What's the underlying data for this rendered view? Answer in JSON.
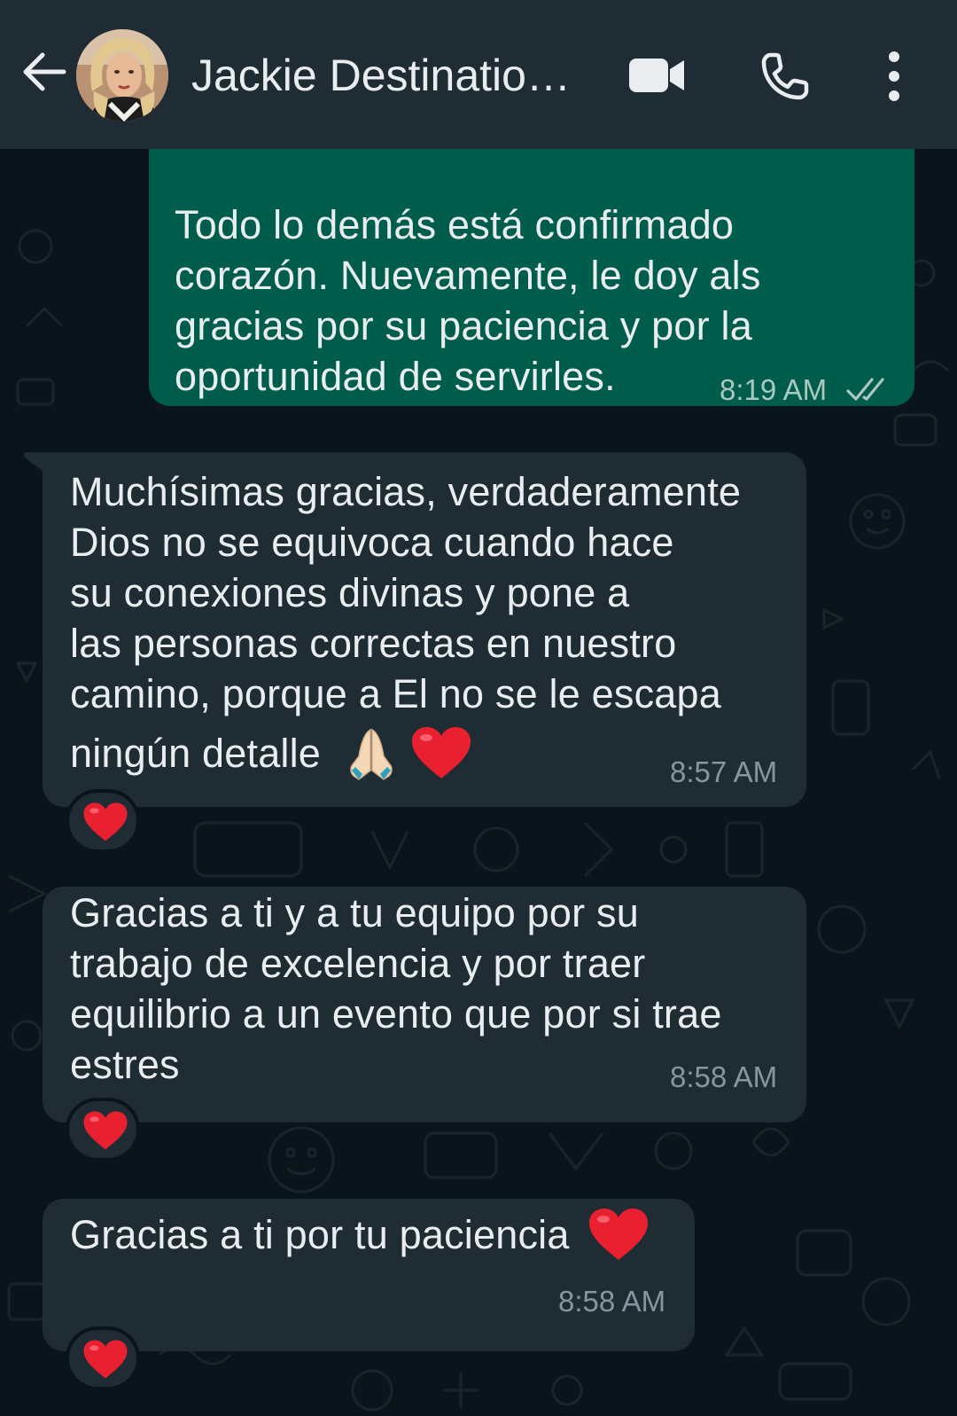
{
  "header": {
    "contact_name": "Jackie Destinatio…",
    "icons": {
      "back": "arrow-left-icon",
      "video": "video-camera-icon",
      "call": "phone-icon",
      "menu": "more-vertical-icon"
    }
  },
  "messages": [
    {
      "direction": "outgoing",
      "text_lines": [
        "Todo lo demás está confirmado",
        "corazón. Nuevamente, le doy als",
        "gracias por su paciencia y por la",
        "oportunidad de servirles."
      ],
      "time": "8:19 AM",
      "status": "read-double-check"
    },
    {
      "direction": "incoming",
      "text_lines": [
        "Muchísimas gracias, verdaderamente",
        "Dios no se equivoca cuando hace",
        "su conexiones divinas y pone a",
        "las personas correctas en nuestro",
        "camino, porque a El no se le escapa",
        "ningún detalle"
      ],
      "emojis": [
        "folded-hands",
        "red-heart"
      ],
      "time": "8:57 AM",
      "reaction": "red-heart"
    },
    {
      "direction": "incoming",
      "text_lines": [
        "Gracias a ti y a tu equipo por su",
        "trabajo de excelencia y por traer",
        "equilibrio a un evento que por si trae",
        "estres"
      ],
      "time": "8:58 AM",
      "reaction": "red-heart"
    },
    {
      "direction": "incoming",
      "text_lines": [
        "Gracias a ti por tu paciencia"
      ],
      "emojis": [
        "red-heart"
      ],
      "time": "8:58 AM",
      "reaction": "red-heart"
    }
  ],
  "colors": {
    "header_bg": "#1f2c34",
    "chat_bg": "#0b141a",
    "outgoing_bubble": "#005c4b",
    "incoming_bubble": "#1f2c34",
    "text": "#e9edef",
    "timestamp": "#8696a0",
    "heart": "#e8202f"
  }
}
